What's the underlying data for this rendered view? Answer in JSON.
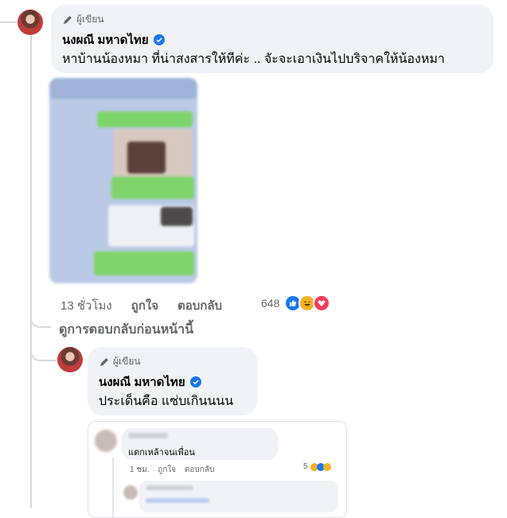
{
  "comments": [
    {
      "author_tag": "ผู้เขียน",
      "name": "นงผณี มหาดไทย",
      "text": "หาบ้านน้องหมา ที่น่าสงสารให้ทีค่ะ .. จัะจะเอาเงินไปบริจาคให้น้องหมา",
      "time": "13 ชั่วโมง",
      "like_label": "ถูกใจ",
      "reply_label": "ตอบกลับ",
      "reaction_count": "648",
      "reactions": [
        "like-icon",
        "haha-icon",
        "love-icon"
      ]
    },
    {
      "author_tag": "ผู้เขียน",
      "name": "นงผณี มหาดไทย",
      "text": "ประเด็นคือ แซ่บเกินนนน"
    }
  ],
  "view_previous_replies": "ดูการตอบกลับก่อนหน้านี้",
  "embedded_screenshot": {
    "comment_text": "แดกเหล้าจนเพื่อน",
    "time": "1 ชม.",
    "like_label": "ถูกใจ",
    "reply_label": "ตอบกลับ",
    "reaction_count": "5"
  },
  "colors": {
    "bubble": "#f0f2f5",
    "verified": "#1877f2",
    "like": "#1877f2",
    "love": "#f33e58",
    "haha": "#f7b125",
    "secondary_text": "#65676b"
  }
}
